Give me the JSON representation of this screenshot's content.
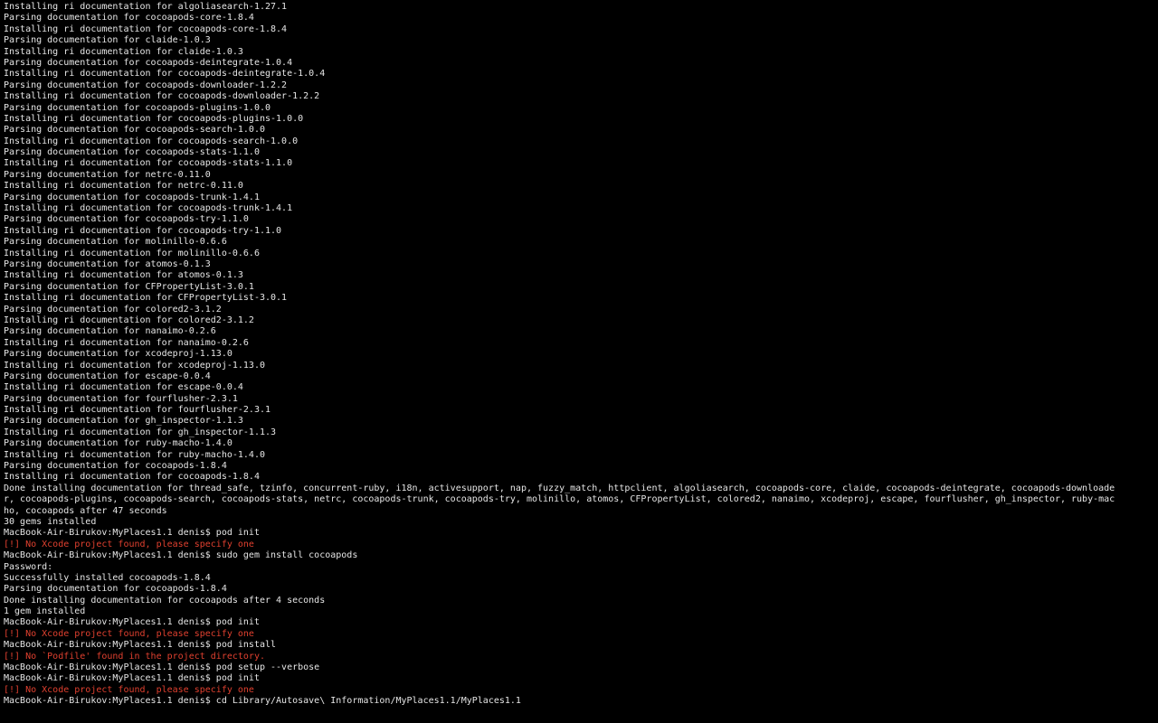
{
  "terminal": {
    "background": "#000000",
    "text_color": "#e6e6e6",
    "error_color": "#e0402f",
    "lines": [
      {
        "text": "Installing ri documentation for algoliasearch-1.27.1",
        "kind": "out"
      },
      {
        "text": "Parsing documentation for cocoapods-core-1.8.4",
        "kind": "out"
      },
      {
        "text": "Installing ri documentation for cocoapods-core-1.8.4",
        "kind": "out"
      },
      {
        "text": "Parsing documentation for claide-1.0.3",
        "kind": "out"
      },
      {
        "text": "Installing ri documentation for claide-1.0.3",
        "kind": "out"
      },
      {
        "text": "Parsing documentation for cocoapods-deintegrate-1.0.4",
        "kind": "out"
      },
      {
        "text": "Installing ri documentation for cocoapods-deintegrate-1.0.4",
        "kind": "out"
      },
      {
        "text": "Parsing documentation for cocoapods-downloader-1.2.2",
        "kind": "out"
      },
      {
        "text": "Installing ri documentation for cocoapods-downloader-1.2.2",
        "kind": "out"
      },
      {
        "text": "Parsing documentation for cocoapods-plugins-1.0.0",
        "kind": "out"
      },
      {
        "text": "Installing ri documentation for cocoapods-plugins-1.0.0",
        "kind": "out"
      },
      {
        "text": "Parsing documentation for cocoapods-search-1.0.0",
        "kind": "out"
      },
      {
        "text": "Installing ri documentation for cocoapods-search-1.0.0",
        "kind": "out"
      },
      {
        "text": "Parsing documentation for cocoapods-stats-1.1.0",
        "kind": "out"
      },
      {
        "text": "Installing ri documentation for cocoapods-stats-1.1.0",
        "kind": "out"
      },
      {
        "text": "Parsing documentation for netrc-0.11.0",
        "kind": "out"
      },
      {
        "text": "Installing ri documentation for netrc-0.11.0",
        "kind": "out"
      },
      {
        "text": "Parsing documentation for cocoapods-trunk-1.4.1",
        "kind": "out"
      },
      {
        "text": "Installing ri documentation for cocoapods-trunk-1.4.1",
        "kind": "out"
      },
      {
        "text": "Parsing documentation for cocoapods-try-1.1.0",
        "kind": "out"
      },
      {
        "text": "Installing ri documentation for cocoapods-try-1.1.0",
        "kind": "out"
      },
      {
        "text": "Parsing documentation for molinillo-0.6.6",
        "kind": "out"
      },
      {
        "text": "Installing ri documentation for molinillo-0.6.6",
        "kind": "out"
      },
      {
        "text": "Parsing documentation for atomos-0.1.3",
        "kind": "out"
      },
      {
        "text": "Installing ri documentation for atomos-0.1.3",
        "kind": "out"
      },
      {
        "text": "Parsing documentation for CFPropertyList-3.0.1",
        "kind": "out"
      },
      {
        "text": "Installing ri documentation for CFPropertyList-3.0.1",
        "kind": "out"
      },
      {
        "text": "Parsing documentation for colored2-3.1.2",
        "kind": "out"
      },
      {
        "text": "Installing ri documentation for colored2-3.1.2",
        "kind": "out"
      },
      {
        "text": "Parsing documentation for nanaimo-0.2.6",
        "kind": "out"
      },
      {
        "text": "Installing ri documentation for nanaimo-0.2.6",
        "kind": "out"
      },
      {
        "text": "Parsing documentation for xcodeproj-1.13.0",
        "kind": "out"
      },
      {
        "text": "Installing ri documentation for xcodeproj-1.13.0",
        "kind": "out"
      },
      {
        "text": "Parsing documentation for escape-0.0.4",
        "kind": "out"
      },
      {
        "text": "Installing ri documentation for escape-0.0.4",
        "kind": "out"
      },
      {
        "text": "Parsing documentation for fourflusher-2.3.1",
        "kind": "out"
      },
      {
        "text": "Installing ri documentation for fourflusher-2.3.1",
        "kind": "out"
      },
      {
        "text": "Parsing documentation for gh_inspector-1.1.3",
        "kind": "out"
      },
      {
        "text": "Installing ri documentation for gh_inspector-1.1.3",
        "kind": "out"
      },
      {
        "text": "Parsing documentation for ruby-macho-1.4.0",
        "kind": "out"
      },
      {
        "text": "Installing ri documentation for ruby-macho-1.4.0",
        "kind": "out"
      },
      {
        "text": "Parsing documentation for cocoapods-1.8.4",
        "kind": "out"
      },
      {
        "text": "Installing ri documentation for cocoapods-1.8.4",
        "kind": "out"
      },
      {
        "text": "Done installing documentation for thread_safe, tzinfo, concurrent-ruby, i18n, activesupport, nap, fuzzy_match, httpclient, algoliasearch, cocoapods-core, claide, cocoapods-deintegrate, cocoapods-downloade",
        "kind": "out"
      },
      {
        "text": "r, cocoapods-plugins, cocoapods-search, cocoapods-stats, netrc, cocoapods-trunk, cocoapods-try, molinillo, atomos, CFPropertyList, colored2, nanaimo, xcodeproj, escape, fourflusher, gh_inspector, ruby-mac",
        "kind": "out"
      },
      {
        "text": "ho, cocoapods after 47 seconds",
        "kind": "out"
      },
      {
        "text": "30 gems installed",
        "kind": "out"
      },
      {
        "text": "MacBook-Air-Birukov:MyPlaces1.1 denis$ pod init",
        "kind": "prompt"
      },
      {
        "text": "[!] No Xcode project found, please specify one",
        "kind": "err"
      },
      {
        "text": "MacBook-Air-Birukov:MyPlaces1.1 denis$ sudo gem install cocoapods",
        "kind": "prompt"
      },
      {
        "text": "Password:",
        "kind": "prompt"
      },
      {
        "text": "Successfully installed cocoapods-1.8.4",
        "kind": "out"
      },
      {
        "text": "Parsing documentation for cocoapods-1.8.4",
        "kind": "out"
      },
      {
        "text": "Done installing documentation for cocoapods after 4 seconds",
        "kind": "out"
      },
      {
        "text": "1 gem installed",
        "kind": "out"
      },
      {
        "text": "MacBook-Air-Birukov:MyPlaces1.1 denis$ pod init",
        "kind": "prompt"
      },
      {
        "text": "[!] No Xcode project found, please specify one",
        "kind": "err"
      },
      {
        "text": "MacBook-Air-Birukov:MyPlaces1.1 denis$ pod install",
        "kind": "prompt"
      },
      {
        "text": "[!] No `Podfile' found in the project directory.",
        "kind": "err"
      },
      {
        "text": "MacBook-Air-Birukov:MyPlaces1.1 denis$ pod setup --verbose",
        "kind": "prompt"
      },
      {
        "text": "MacBook-Air-Birukov:MyPlaces1.1 denis$ pod init",
        "kind": "prompt"
      },
      {
        "text": "[!] No Xcode project found, please specify one",
        "kind": "err"
      },
      {
        "text": "MacBook-Air-Birukov:MyPlaces1.1 denis$ cd Library/Autosave\\ Information/MyPlaces1.1/MyPlaces1.1",
        "kind": "prompt"
      }
    ]
  }
}
